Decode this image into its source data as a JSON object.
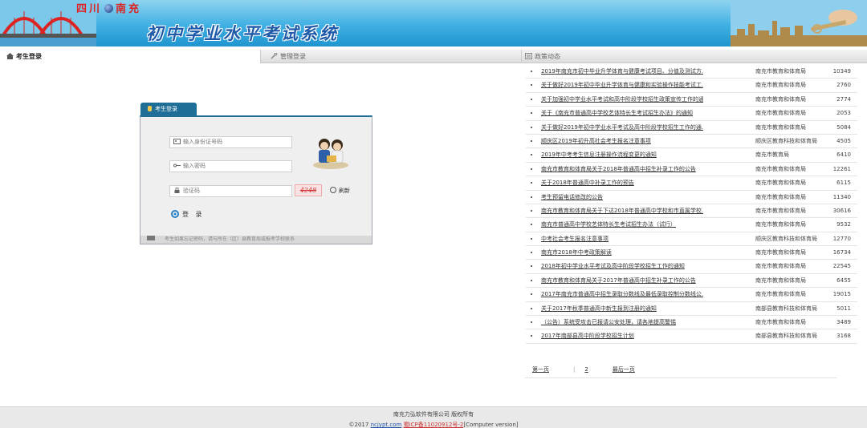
{
  "header": {
    "city_left": "四川",
    "city_right": "南充",
    "system_title": "初中学业水平考试系统"
  },
  "tabs": {
    "student_login": "考生登录",
    "admin_login": "管理登录",
    "news": "政策动态"
  },
  "login": {
    "panel_title": "考生登录",
    "id_placeholder": "输入身份证号码",
    "password_placeholder": "输入密码",
    "captcha_placeholder": "验证码",
    "captcha_code": "4248",
    "refresh_label": "刷新",
    "submit_label": "登 录",
    "footer_note": "考生如果忘记密码，请与所在（区）县教育局或报考学校联系"
  },
  "news": [
    {
      "title": "2019年南充市初中毕业升学体育与健康考试项目、分值及测试方...",
      "dept": "南充市教育和体育局",
      "views": "10349"
    },
    {
      "title": "关于做好2019年初中毕业升学体育与健康和实验操作技能考试工...",
      "dept": "南充市教育和体育局",
      "views": "2760"
    },
    {
      "title": "关于加强初中学业水平考试和高中阶段学校招生政策宣传工作的通知",
      "dept": "南充市教育和体育局",
      "views": "2774"
    },
    {
      "title": "关于《南充市普通高中学校艺体特长生考试招生办法》的通知",
      "dept": "南充市教育和体育局",
      "views": "2053"
    },
    {
      "title": "关于做好2019年初中学业水平考试及高中阶段学校招生工作的通...",
      "dept": "南充市教育和体育局",
      "views": "5084"
    },
    {
      "title": "顺庆区2019年初升高社会考生报名注意事项",
      "dept": "顺庆区教育科技和体育局",
      "views": "4505"
    },
    {
      "title": "2019年中考考生信息注册操作流程变更的通知",
      "dept": "南充市教育局",
      "views": "6410"
    },
    {
      "title": "南充市教育和体育局关于2018年普通高中招生补录工作的公告",
      "dept": "南充市教育和体育局",
      "views": "12261"
    },
    {
      "title": "关于2018年普通高中补录工作的预告",
      "dept": "南充市教育和体育局",
      "views": "6115"
    },
    {
      "title": "考生预留电话修改的公告",
      "dept": "南充市教育和体育局",
      "views": "11340"
    },
    {
      "title": "南充市教育和体育局关于下达2018年普通高中学校和市直属学校...",
      "dept": "南充市教育和体育局",
      "views": "30616"
    },
    {
      "title": "南充市普通高中学校艺体特长生考试招生办法（试行）",
      "dept": "南充市教育和体育局",
      "views": "9532"
    },
    {
      "title": "中考社会考生报名注意事项",
      "dept": "顺庆区教育科技和体育局",
      "views": "12770"
    },
    {
      "title": "南充市2018年中考政策解读",
      "dept": "南充市教育和体育局",
      "views": "16734"
    },
    {
      "title": "2018年初中学业水平考试及高中阶段学校招生工作的通知",
      "dept": "南充市教育和体育局",
      "views": "22545"
    },
    {
      "title": "南充市教育和体育局关于2017年普通高中招生补录工作的公告",
      "dept": "南充市教育和体育局",
      "views": "6455"
    },
    {
      "title": "2017年南充市普通高中招生录取分数线及最低录取控制分数线公...",
      "dept": "南充市教育和体育局",
      "views": "19015"
    },
    {
      "title": "关于2017年秋季普通高中新生报到注册的通知",
      "dept": "南部县教育科技和体育局",
      "views": "5011"
    },
    {
      "title": "（公告）系统受攻击已报请公安处理，请各地提高警惕",
      "dept": "南充市教育和体育局",
      "views": "3489"
    },
    {
      "title": "2017年南部县高中阶段学校招生计划",
      "dept": "南部县教育科技和体育局",
      "views": "3168"
    }
  ],
  "pager": {
    "first": "第一页",
    "page": "2",
    "last": "最后一页"
  },
  "footer": {
    "company": "南充力弘软件有限公司 版权所有",
    "copyright": "©2017",
    "domain": "ncjypt.com",
    "icp": "蜀ICP备11020912号-2",
    "version": "[Computer version]"
  }
}
